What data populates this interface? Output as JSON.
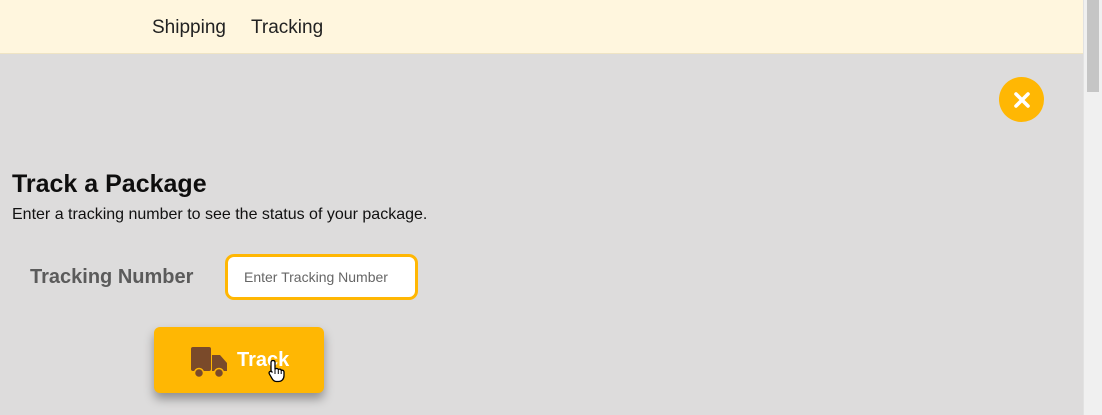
{
  "nav": {
    "items": [
      {
        "label": "Shipping"
      },
      {
        "label": "Tracking"
      }
    ]
  },
  "modal": {
    "close_icon": "close-icon",
    "title": "Track a Package",
    "subtitle": "Enter a tracking number to see the status of your package.",
    "field_label": "Tracking Number",
    "input": {
      "value": "",
      "placeholder": "Enter Tracking Number"
    },
    "track_button": {
      "label": "Track",
      "icon": "truck-icon"
    }
  },
  "colors": {
    "accent": "#ffb703",
    "nav_bg": "#fff6de",
    "overlay_bg": "#dddcdc",
    "truck_icon": "#7a4a2a"
  }
}
